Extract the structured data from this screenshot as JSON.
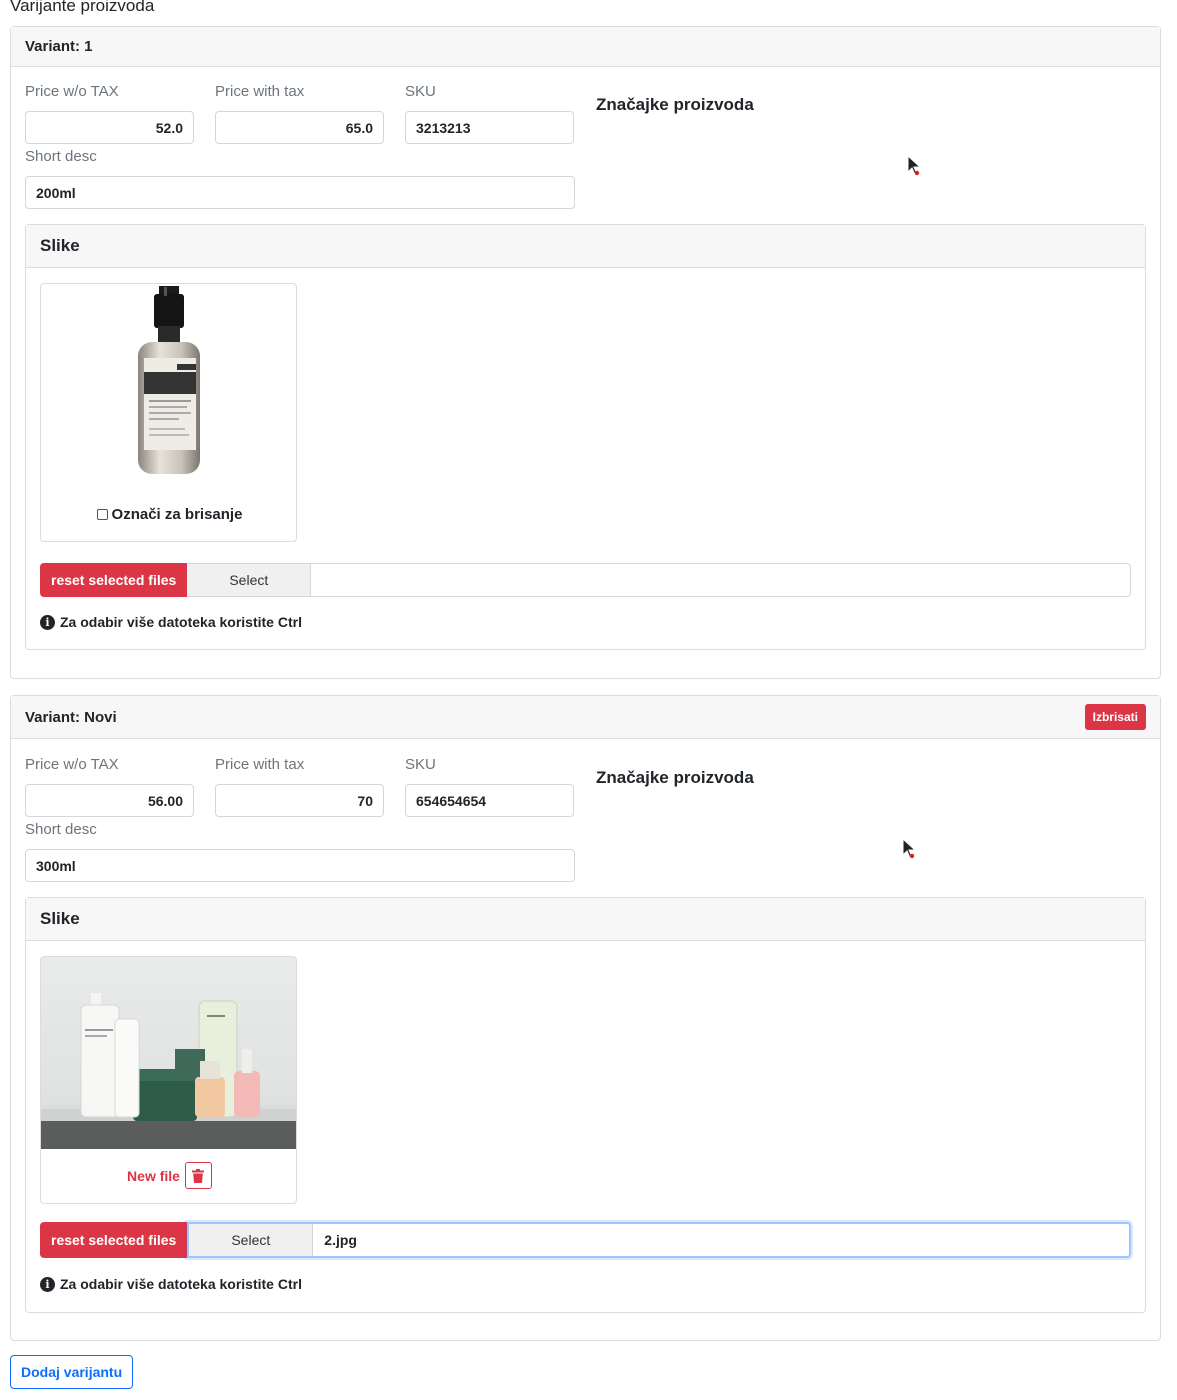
{
  "section_title": "Varijante proizvoda",
  "variants": [
    {
      "title": "Variant: 1",
      "price_wo_tax_label": "Price w/o TAX",
      "price_wo_tax_value": "52.0",
      "price_with_tax_label": "Price with tax",
      "price_with_tax_value": "65.0",
      "sku_label": "SKU",
      "sku_value": "3213213",
      "short_desc_label": "Short desc",
      "short_desc_value": "200ml",
      "features_title": "Značajke proizvoda",
      "images_title": "Slike",
      "image_caption": "Označi za brisanje",
      "reset_label": "reset selected files",
      "select_label": "Select",
      "selected_file": "",
      "hint": "Za odabir više datoteka koristite Ctrl"
    },
    {
      "title": "Variant: Novi",
      "delete_label": "Izbrisati",
      "price_wo_tax_label": "Price w/o TAX",
      "price_wo_tax_value": "56.00",
      "price_with_tax_label": "Price with tax",
      "price_with_tax_value": "70",
      "sku_label": "SKU",
      "sku_value": "654654654",
      "short_desc_label": "Short desc",
      "short_desc_value": "300ml",
      "features_title": "Značajke proizvoda",
      "images_title": "Slike",
      "image_caption": "New file",
      "reset_label": "reset selected files",
      "select_label": "Select",
      "selected_file": "2.jpg",
      "hint": "Za odabir više datoteka koristite Ctrl"
    }
  ],
  "add_variant_label": "Dodaj varijantu",
  "colors": {
    "danger": "#dc3545",
    "primary": "#0d6efd",
    "header_bg": "#f7f7f7"
  },
  "icons": {
    "info": "info-icon",
    "trash": "trash-icon",
    "cursor": "cursor-icon"
  }
}
